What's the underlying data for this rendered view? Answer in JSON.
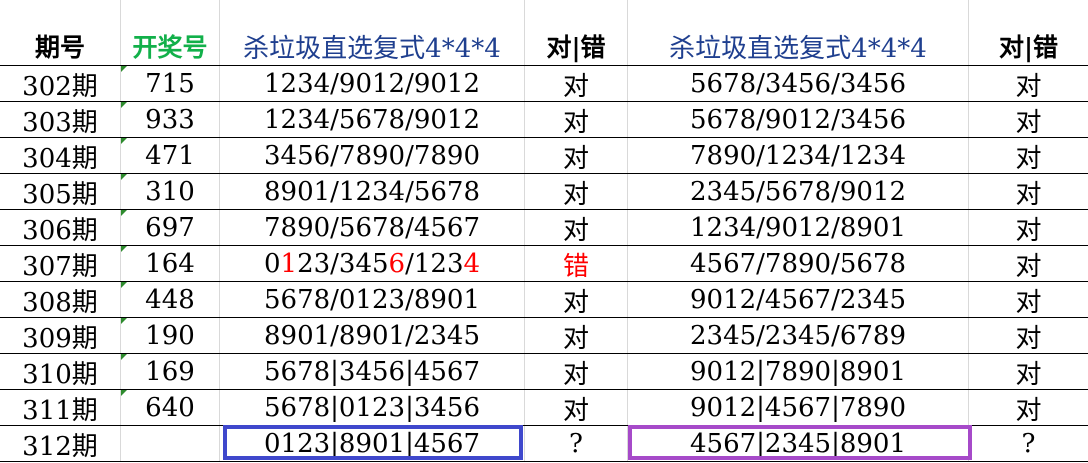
{
  "colors": {
    "header_green": "#12b04a",
    "header_blue": "#1f3f8f",
    "error_red": "#ff0000",
    "box_blue": "#3f48cc",
    "box_purple": "#a64ac9",
    "marker_green": "#2e8b2e"
  },
  "header": {
    "period": "期号",
    "draw": "开奖号",
    "group_a_title": "杀垃圾直选复式4*4*4",
    "group_a_result": "对|错",
    "group_b_title": "杀垃圾直选复式4*4*4",
    "group_b_result": "对|错"
  },
  "rows": [
    {
      "period": "302期",
      "draw": "715",
      "a": [
        {
          "t": "1234/9012/9012"
        }
      ],
      "a_result": "对",
      "a_wrong": false,
      "b": "5678/3456/3456",
      "b_result": "对"
    },
    {
      "period": "303期",
      "draw": "933",
      "a": [
        {
          "t": "1234/5678/9012"
        }
      ],
      "a_result": "对",
      "a_wrong": false,
      "b": "5678/9012/3456",
      "b_result": "对"
    },
    {
      "period": "304期",
      "draw": "471",
      "a": [
        {
          "t": "3456/7890/7890"
        }
      ],
      "a_result": "对",
      "a_wrong": false,
      "b": "7890/1234/1234",
      "b_result": "对"
    },
    {
      "period": "305期",
      "draw": "310",
      "a": [
        {
          "t": "8901/1234/5678"
        }
      ],
      "a_result": "对",
      "a_wrong": false,
      "b": "2345/5678/9012",
      "b_result": "对"
    },
    {
      "period": "306期",
      "draw": "697",
      "a": [
        {
          "t": "7890/5678/4567"
        }
      ],
      "a_result": "对",
      "a_wrong": false,
      "b": "1234/9012/8901",
      "b_result": "对"
    },
    {
      "period": "307期",
      "draw": "164",
      "a": [
        {
          "t": "0"
        },
        {
          "t": "1",
          "red": true
        },
        {
          "t": "23/345"
        },
        {
          "t": "6",
          "red": true
        },
        {
          "t": "/123"
        },
        {
          "t": "4",
          "red": true
        }
      ],
      "a_result": "错",
      "a_wrong": true,
      "b": "4567/7890/5678",
      "b_result": "对"
    },
    {
      "period": "308期",
      "draw": "448",
      "a": [
        {
          "t": "5678/0123/8901"
        }
      ],
      "a_result": "对",
      "a_wrong": false,
      "b": "9012/4567/2345",
      "b_result": "对"
    },
    {
      "period": "309期",
      "draw": "190",
      "a": [
        {
          "t": "8901/8901/2345"
        }
      ],
      "a_result": "对",
      "a_wrong": false,
      "b": "2345/2345/6789",
      "b_result": "对"
    },
    {
      "period": "310期",
      "draw": "169",
      "a": [
        {
          "t": "5678|3456|4567"
        }
      ],
      "a_result": "对",
      "a_wrong": false,
      "b": "9012|7890|8901",
      "b_result": "对"
    },
    {
      "period": "311期",
      "draw": "640",
      "a": [
        {
          "t": "5678|0123|3456"
        }
      ],
      "a_result": "对",
      "a_wrong": false,
      "b": "9012|4567|7890",
      "b_result": "对"
    },
    {
      "period": "312期",
      "draw": "",
      "a": [
        {
          "t": "0123|8901|4567"
        }
      ],
      "a_result": "?",
      "a_wrong": false,
      "b": "4567|2345|8901",
      "b_result": "?"
    }
  ]
}
